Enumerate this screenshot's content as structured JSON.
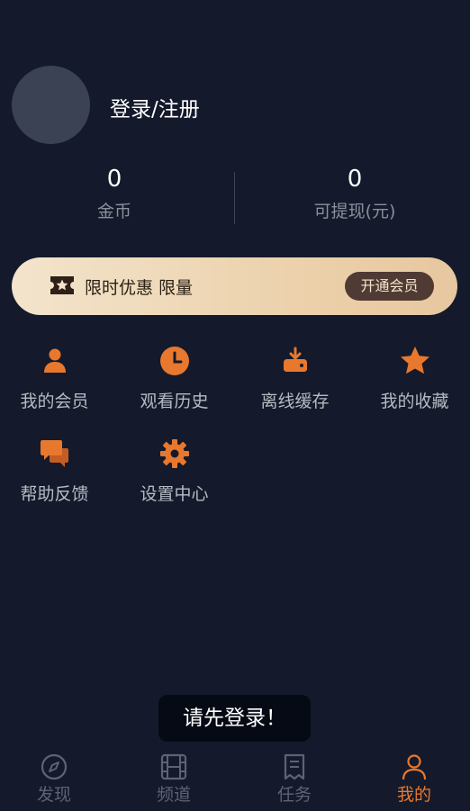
{
  "profile": {
    "login_label": "登录/注册"
  },
  "stats": {
    "coins": {
      "value": "0",
      "label": "金币"
    },
    "cash": {
      "value": "0",
      "label": "可提现(元)"
    }
  },
  "promo": {
    "text": "限时优惠 限量",
    "button": "开通会员"
  },
  "menu": [
    {
      "label": "我的会员",
      "icon": "member-icon"
    },
    {
      "label": "观看历史",
      "icon": "clock-icon"
    },
    {
      "label": "离线缓存",
      "icon": "download-icon"
    },
    {
      "label": "我的收藏",
      "icon": "star-icon"
    },
    {
      "label": "帮助反馈",
      "icon": "chat-icon"
    },
    {
      "label": "设置中心",
      "icon": "gear-icon"
    }
  ],
  "toast": {
    "text": "请先登录！"
  },
  "tabbar": [
    {
      "label": "发现",
      "icon": "compass-icon",
      "active": false
    },
    {
      "label": "频道",
      "icon": "film-icon",
      "active": false
    },
    {
      "label": "任务",
      "icon": "task-icon",
      "active": false
    },
    {
      "label": "我的",
      "icon": "user-icon",
      "active": true
    }
  ],
  "colors": {
    "background": "#141a2b",
    "accent": "#e8782e",
    "promo_button": "#4f3b34"
  }
}
